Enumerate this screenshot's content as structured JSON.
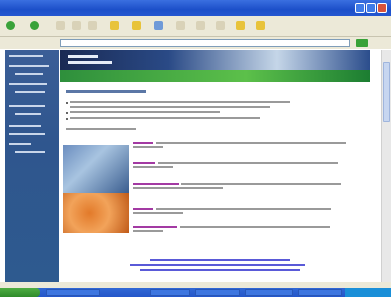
{
  "window": {
    "title": "",
    "controls": {
      "minimize": "minimize",
      "maximize": "maximize",
      "close": "close"
    }
  },
  "toolbar": {
    "items": []
  },
  "address": {
    "value": "",
    "links_label": ""
  },
  "sidebar": {
    "items": []
  },
  "banner": {
    "logo_text": ""
  },
  "intro": {
    "title": "",
    "lines": []
  },
  "sections": [],
  "footer": {
    "links": []
  },
  "colors": {
    "titlebar": "#1c4fc9",
    "sidebar": "#2f568e",
    "section_title": "#8a2a8a",
    "footer_link": "#3b3bcc",
    "banner_green": "#5cc04a"
  },
  "icons": [
    "back-icon",
    "forward-icon",
    "stop-icon",
    "refresh-icon",
    "home-icon",
    "search-icon",
    "favorites-icon",
    "history-icon",
    "mail-icon",
    "print-icon"
  ]
}
